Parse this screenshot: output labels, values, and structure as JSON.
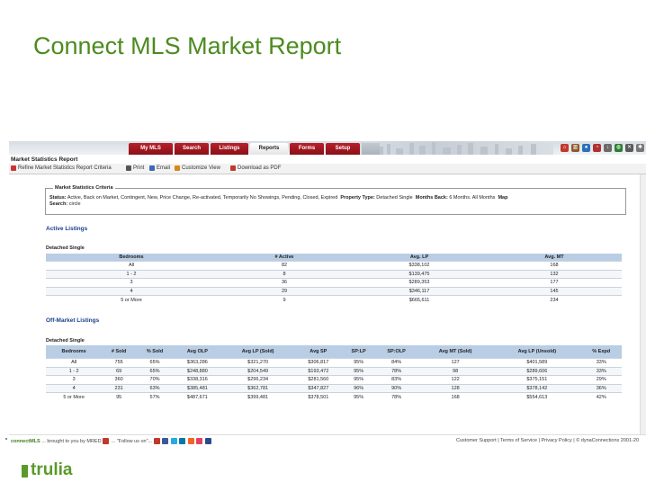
{
  "slide": {
    "title": "Connect MLS Market Report"
  },
  "nav": {
    "tabs": [
      {
        "label": "My MLS"
      },
      {
        "label": "Search"
      },
      {
        "label": "Listings"
      },
      {
        "label": "Reports",
        "active": true
      },
      {
        "label": "Forms"
      },
      {
        "label": "Setup"
      }
    ]
  },
  "page": {
    "heading": "Market Statistics Report"
  },
  "toolbar": {
    "refine": "Refine Market Statistics Report Criteria",
    "print": "Print",
    "email": "Email",
    "customize": "Customize View",
    "download": "Download as PDF"
  },
  "criteria": {
    "title": "Market Statistics Criteria",
    "status_label": "Status:",
    "status_value": "Active, Back on Market, Contingent, New, Price Change, Re-activated, Temporarily No Showings, Pending, Closed, Expired",
    "property_type_label": "Property Type:",
    "property_type_value": "Detached Single",
    "months_back_label": "Months Back:",
    "months_back_value": "6 Months. All Months",
    "map_label": "Map",
    "search_label": "Search:",
    "search_value": "circle"
  },
  "active": {
    "title": "Active Listings",
    "subtitle": "Detached Single",
    "headers": [
      "Bedrooms",
      "# Active",
      "Avg. LP",
      "Avg. MT"
    ],
    "rows": [
      [
        "All",
        "82",
        "$338,102",
        "168"
      ],
      [
        "1 - 2",
        "8",
        "$139,475",
        "132"
      ],
      [
        "3",
        "36",
        "$289,353",
        "177"
      ],
      [
        "4",
        "29",
        "$346,117",
        "145"
      ],
      [
        "5 or More",
        "9",
        "$665,611",
        "234"
      ]
    ]
  },
  "offmarket": {
    "title": "Off-Market Listings",
    "subtitle": "Detached Single",
    "headers": [
      "Bedrooms",
      "# Sold",
      "% Sold",
      "Avg OLP",
      "Avg LP (Sold)",
      "Avg SP",
      "SP:LP",
      "SP:OLP",
      "Avg MT (Sold)",
      "Avg LP (Unsold)",
      "% Expd"
    ],
    "rows": [
      [
        "All",
        "755",
        "65%",
        "$363,286",
        "$321,270",
        "$306,817",
        "95%",
        "84%",
        "127",
        "$401,589",
        "33%"
      ],
      [
        "1 - 2",
        "69",
        "65%",
        "$248,880",
        "$204,549",
        "$193,472",
        "95%",
        "78%",
        "98",
        "$289,606",
        "33%"
      ],
      [
        "3",
        "360",
        "70%",
        "$338,316",
        "$296,234",
        "$281,560",
        "95%",
        "83%",
        "122",
        "$375,151",
        "29%"
      ],
      [
        "4",
        "231",
        "63%",
        "$385,481",
        "$362,781",
        "$347,827",
        "96%",
        "90%",
        "128",
        "$378,142",
        "36%"
      ],
      [
        "5 or More",
        "95",
        "57%",
        "$487,671",
        "$399,481",
        "$378,501",
        "95%",
        "78%",
        "168",
        "$554,613",
        "42%"
      ]
    ]
  },
  "footer": {
    "brand": "connectMLS",
    "tagline": "... brought to you by MRED",
    "follow": "... \"Follow us on\"...",
    "right": "Customer Support | Terms of Service | Privacy Policy | © dynaConnections 2001-20"
  },
  "logo": {
    "text": "trulia"
  }
}
